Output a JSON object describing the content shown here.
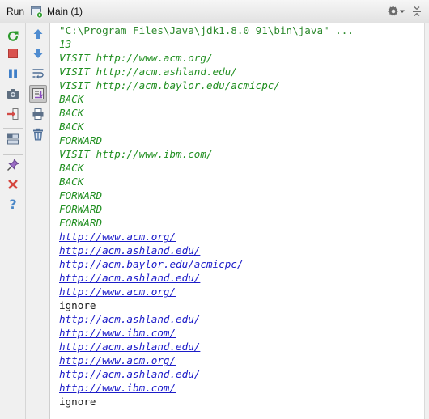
{
  "window": {
    "run_label": "Run",
    "tab_label": "Main (1)"
  },
  "toolbar_icons": [
    "rerun-icon",
    "stop-icon",
    "pause-icon",
    "dump-threads-icon",
    "exit-icon",
    "layout-icon",
    "pin-icon",
    "close-icon",
    "help-icon",
    "up-arrow-icon",
    "down-arrow-icon",
    "soft-wrap-icon",
    "scroll-to-end-icon",
    "print-icon",
    "clear-all-icon"
  ],
  "console": {
    "lines": [
      {
        "text": "\"C:\\Program Files\\Java\\jdk1.8.0_91\\bin\\java\" ...",
        "kind": "cmd"
      },
      {
        "text": "13",
        "kind": "input"
      },
      {
        "text": "VISIT http://www.acm.org/",
        "kind": "input"
      },
      {
        "text": "VISIT http://acm.ashland.edu/",
        "kind": "input"
      },
      {
        "text": "VISIT http://acm.baylor.edu/acmicpc/",
        "kind": "input"
      },
      {
        "text": "BACK",
        "kind": "input"
      },
      {
        "text": "BACK",
        "kind": "input"
      },
      {
        "text": "BACK",
        "kind": "input"
      },
      {
        "text": "FORWARD",
        "kind": "input"
      },
      {
        "text": "VISIT http://www.ibm.com/",
        "kind": "input"
      },
      {
        "text": "BACK",
        "kind": "input"
      },
      {
        "text": "BACK",
        "kind": "input"
      },
      {
        "text": "FORWARD",
        "kind": "input"
      },
      {
        "text": "FORWARD",
        "kind": "input"
      },
      {
        "text": "FORWARD",
        "kind": "input"
      },
      {
        "text": "http://www.acm.org/",
        "kind": "link"
      },
      {
        "text": "http://acm.ashland.edu/",
        "kind": "link"
      },
      {
        "text": "http://acm.baylor.edu/acmicpc/",
        "kind": "link"
      },
      {
        "text": "http://acm.ashland.edu/",
        "kind": "link"
      },
      {
        "text": "http://www.acm.org/",
        "kind": "link"
      },
      {
        "text": "ignore",
        "kind": "out"
      },
      {
        "text": "http://acm.ashland.edu/",
        "kind": "link"
      },
      {
        "text": "http://www.ibm.com/",
        "kind": "link"
      },
      {
        "text": "http://acm.ashland.edu/",
        "kind": "link"
      },
      {
        "text": "http://www.acm.org/",
        "kind": "link"
      },
      {
        "text": "http://acm.ashland.edu/",
        "kind": "link"
      },
      {
        "text": "http://www.ibm.com/",
        "kind": "link"
      },
      {
        "text": "ignore",
        "kind": "out"
      }
    ]
  },
  "colors": {
    "command": "#2e8a2e",
    "user_input": "#218f21",
    "hyperlink": "#1c1cc8",
    "output": "#1a1a1a"
  }
}
